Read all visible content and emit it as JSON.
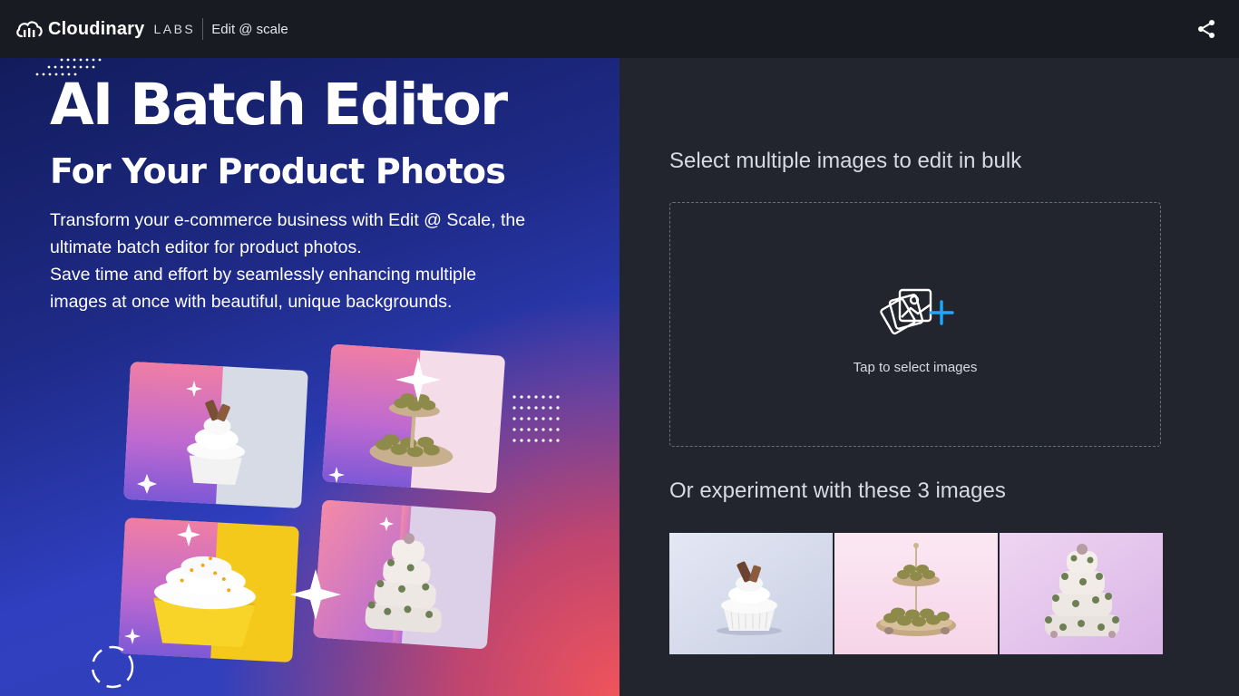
{
  "header": {
    "brand": "Cloudinary",
    "labs": "LABS",
    "product": "Edit @ scale",
    "icons": {
      "logo": "cloudinary-cloud-icon",
      "share": "share-icon"
    }
  },
  "hero": {
    "title": "AI Batch Editor",
    "subtitle": "For Your Product Photos",
    "description": [
      "Transform your e-commerce business with Edit @ Scale, the",
      "ultimate batch editor for product photos.",
      "Save time and effort by seamlessly enhancing multiple",
      "images at once with beautiful, unique backgrounds."
    ]
  },
  "upload": {
    "heading": "Select multiple images to edit in bulk",
    "dropzone_label": "Tap to select images",
    "icon": "add-images-icon",
    "accent_color": "#1ea7fd"
  },
  "samples": {
    "heading": "Or experiment with these 3 images",
    "items": [
      "cupcake",
      "macaron stand",
      "floral cake"
    ]
  },
  "colors": {
    "topbar": "#181b22",
    "panel": "#22252e",
    "hero_start": "#121c5c",
    "hero_end": "#f0545a"
  }
}
